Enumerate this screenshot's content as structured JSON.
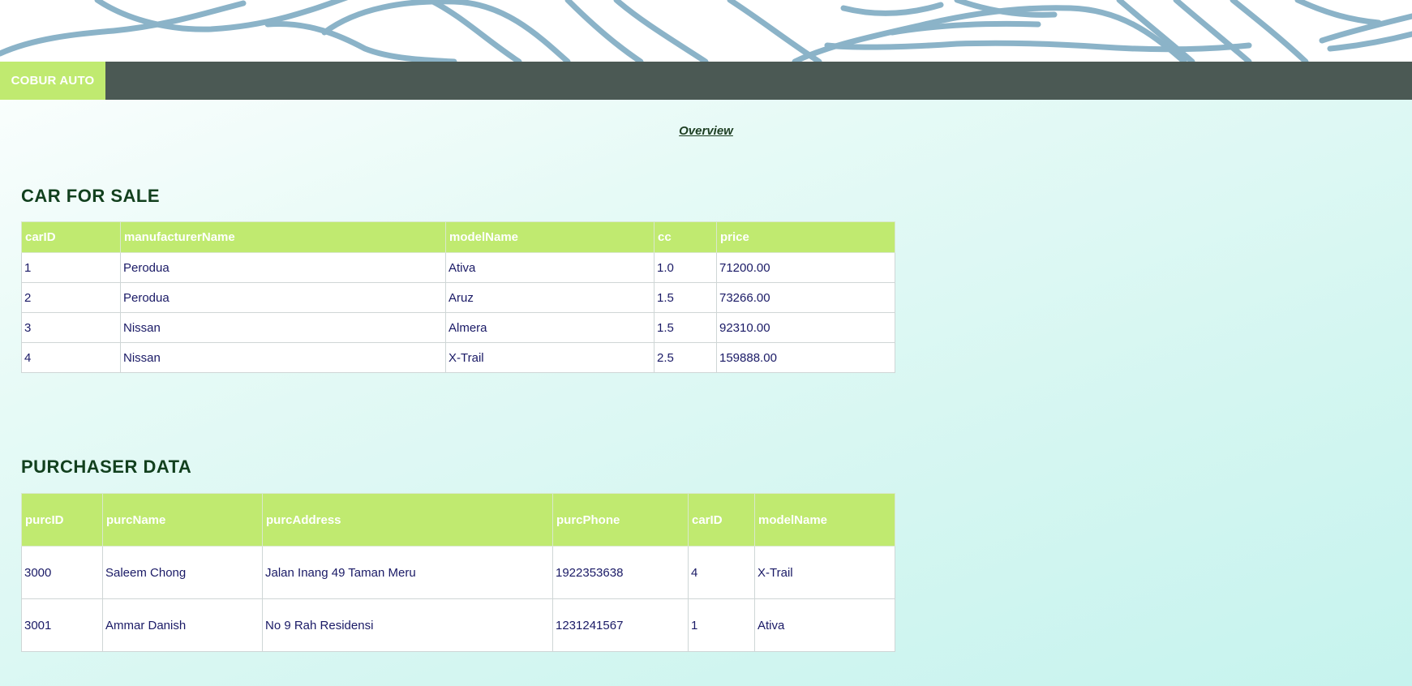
{
  "nav": {
    "brand": "COBUR AUTO"
  },
  "main": {
    "overview_link": "Overview"
  },
  "car_section": {
    "title": "CAR FOR SALE",
    "columns": [
      "carID",
      "manufacturerName",
      "modelName",
      "cc",
      "price"
    ],
    "rows": [
      [
        "1",
        "Perodua",
        "Ativa",
        "1.0",
        "71200.00"
      ],
      [
        "2",
        "Perodua",
        "Aruz",
        "1.5",
        "73266.00"
      ],
      [
        "3",
        "Nissan",
        "Almera",
        "1.5",
        "92310.00"
      ],
      [
        "4",
        "Nissan",
        "X-Trail",
        "2.5",
        "159888.00"
      ]
    ]
  },
  "purchaser_section": {
    "title": "PURCHASER DATA",
    "columns": [
      "purcID",
      "purcName",
      "purcAddress",
      "purcPhone",
      "carID",
      "modelName"
    ],
    "rows": [
      [
        "3000",
        "Saleem Chong",
        "Jalan Inang 49 Taman Meru",
        "1922353638",
        "4",
        "X-Trail"
      ],
      [
        "3001",
        "Ammar Danish",
        "No 9 Rah Residensi",
        "1231241567",
        "1",
        "Ativa"
      ]
    ]
  },
  "colors": {
    "brand_accent": "#c0ea70",
    "navbar": "#4b5954",
    "heading": "#12401e",
    "cell_text": "#1a1a66",
    "banner_waves": "#8bb3c8"
  }
}
